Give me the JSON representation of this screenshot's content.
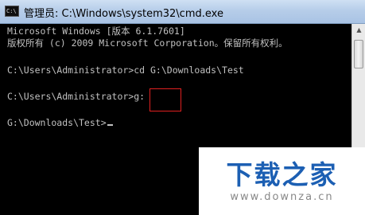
{
  "window": {
    "icon": "cmd-icon",
    "icon_text": "C:\\",
    "title": "管理员: C:\\Windows\\system32\\cmd.exe"
  },
  "console": {
    "lines": [
      "Microsoft Windows [版本 6.1.7601]",
      "版权所有 (c) 2009 Microsoft Corporation。保留所有权利。",
      "",
      "C:\\Users\\Administrator>cd G:\\Downloads\\Test",
      "",
      "C:\\Users\\Administrator>g:",
      "",
      "G:\\Downloads\\Test>"
    ],
    "text_color": "#c0c0c0",
    "background": "#000000"
  },
  "scrollbar": {
    "up_icon": "arrow-up-icon",
    "down_icon": "arrow-down-icon"
  },
  "highlight": {
    "color": "#e02020"
  },
  "watermark": {
    "title": "下载之家",
    "url": "www.downza.cn",
    "color": "#1c5fb3"
  }
}
